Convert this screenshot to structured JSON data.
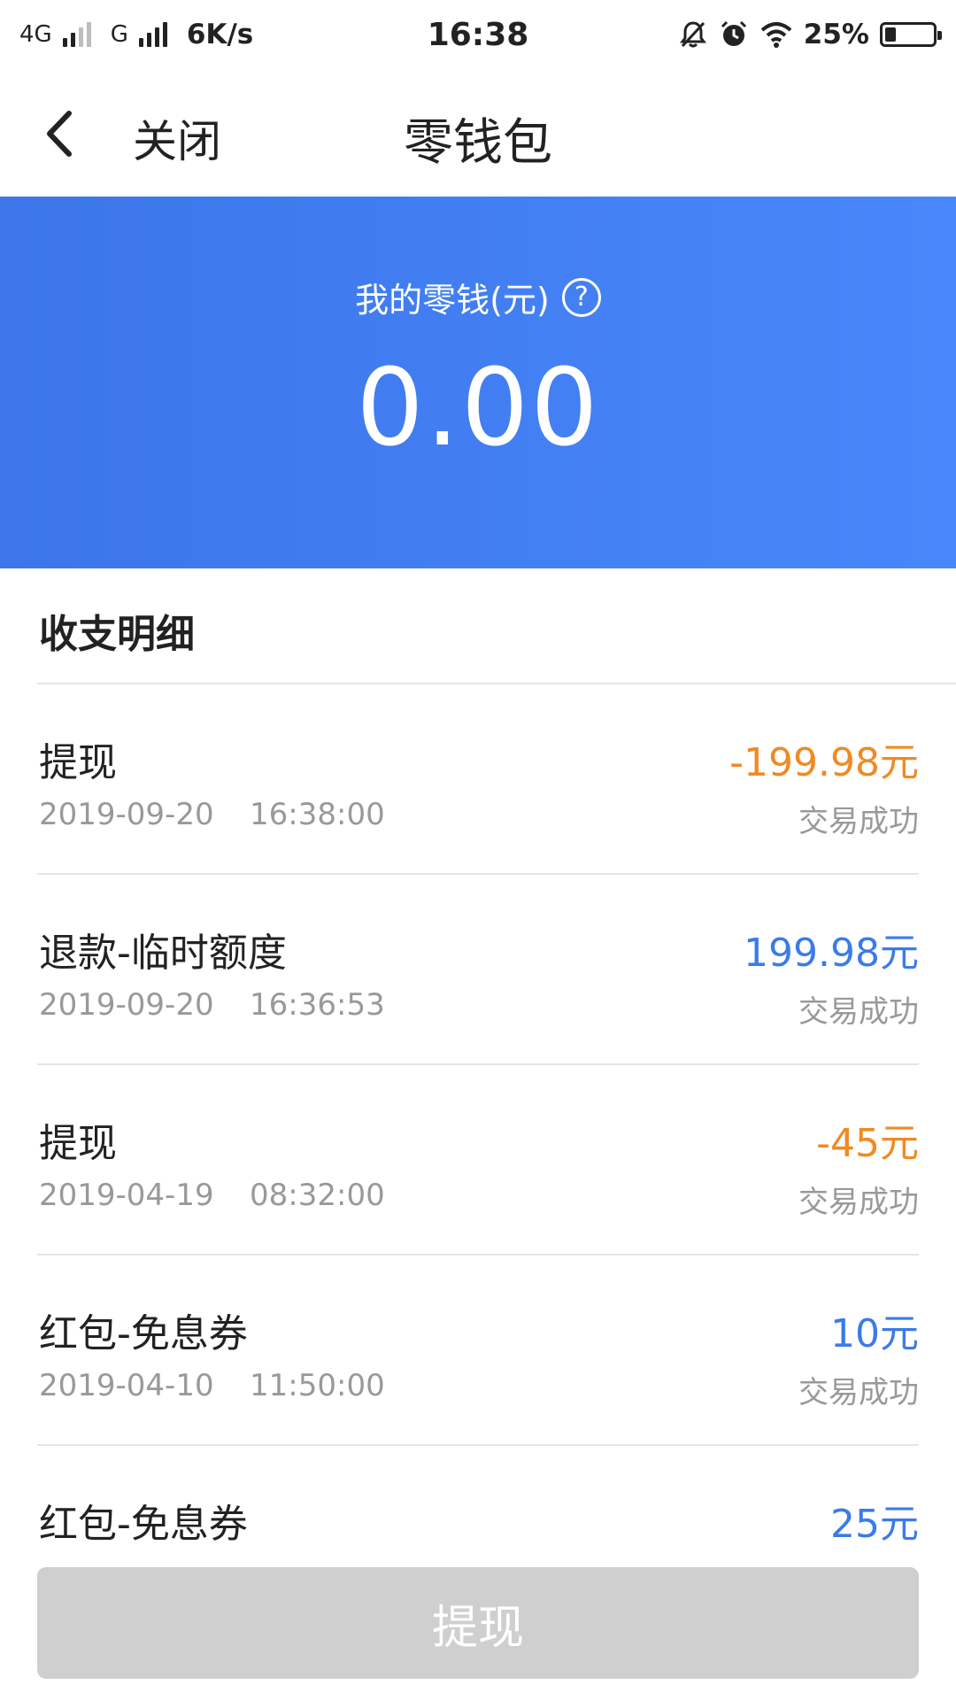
{
  "status_bar": {
    "network1": "4G",
    "network2": "G",
    "speed": "6K/s",
    "time": "16:38",
    "battery": "25%",
    "icons": [
      "signal-icon",
      "mute-bell-icon",
      "alarm-icon",
      "wifi-icon",
      "battery-icon"
    ]
  },
  "nav": {
    "back_icon": "chevron-left-icon",
    "close_label": "关闭",
    "title": "零钱包"
  },
  "wallet": {
    "label": "我的零钱(元)",
    "help_icon": "question-circle-icon",
    "amount": "0.00"
  },
  "section": {
    "title": "收支明细"
  },
  "transactions": [
    {
      "title": "提现",
      "date": "2019-09-20",
      "time": "16:38:00",
      "amount": "-199.98元",
      "status": "交易成功",
      "sign": "neg"
    },
    {
      "title": "退款-临时额度",
      "date": "2019-09-20",
      "time": "16:36:53",
      "amount": "199.98元",
      "status": "交易成功",
      "sign": "pos"
    },
    {
      "title": "提现",
      "date": "2019-04-19",
      "time": "08:32:00",
      "amount": "-45元",
      "status": "交易成功",
      "sign": "neg"
    },
    {
      "title": "红包-免息券",
      "date": "2019-04-10",
      "time": "11:50:00",
      "amount": "10元",
      "status": "交易成功",
      "sign": "pos"
    },
    {
      "title": "红包-免息券",
      "date": "",
      "time": "",
      "amount": "25元",
      "status": "",
      "sign": "pos"
    }
  ],
  "footer": {
    "withdraw_label": "提现"
  },
  "colors": {
    "hero_start": "#3c76e9",
    "hero_end": "#4887fb",
    "negative_amount": "#f08a23",
    "positive_amount": "#3b7bea",
    "button_disabled": "#cfcfcf"
  }
}
